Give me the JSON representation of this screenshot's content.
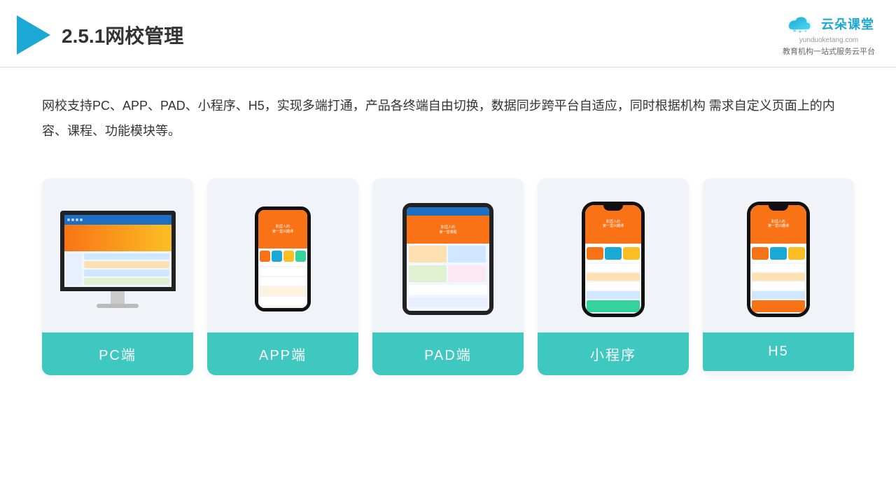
{
  "header": {
    "title": "2.5.1网校管理",
    "logo_name": "云朵课堂",
    "logo_url": "yunduoketang.com",
    "logo_tagline": "教育机构一站\n式服务云平台"
  },
  "description": "网校支持PC、APP、PAD、小程序、H5，实现多端打通，产品各终端自由切换，数据同步跨平台自适应，同时根据机构\n需求自定义页面上的内容、课程、功能模块等。",
  "cards": [
    {
      "id": "pc",
      "label": "PC端"
    },
    {
      "id": "app",
      "label": "APP端"
    },
    {
      "id": "pad",
      "label": "PAD端"
    },
    {
      "id": "miniprogram",
      "label": "小程序"
    },
    {
      "id": "h5",
      "label": "H5"
    }
  ],
  "colors": {
    "accent": "#3ec8c0",
    "header_line": "#e8e8e8",
    "blue": "#1ba8d5",
    "triangle": "#1ba8d5",
    "text": "#333333"
  }
}
